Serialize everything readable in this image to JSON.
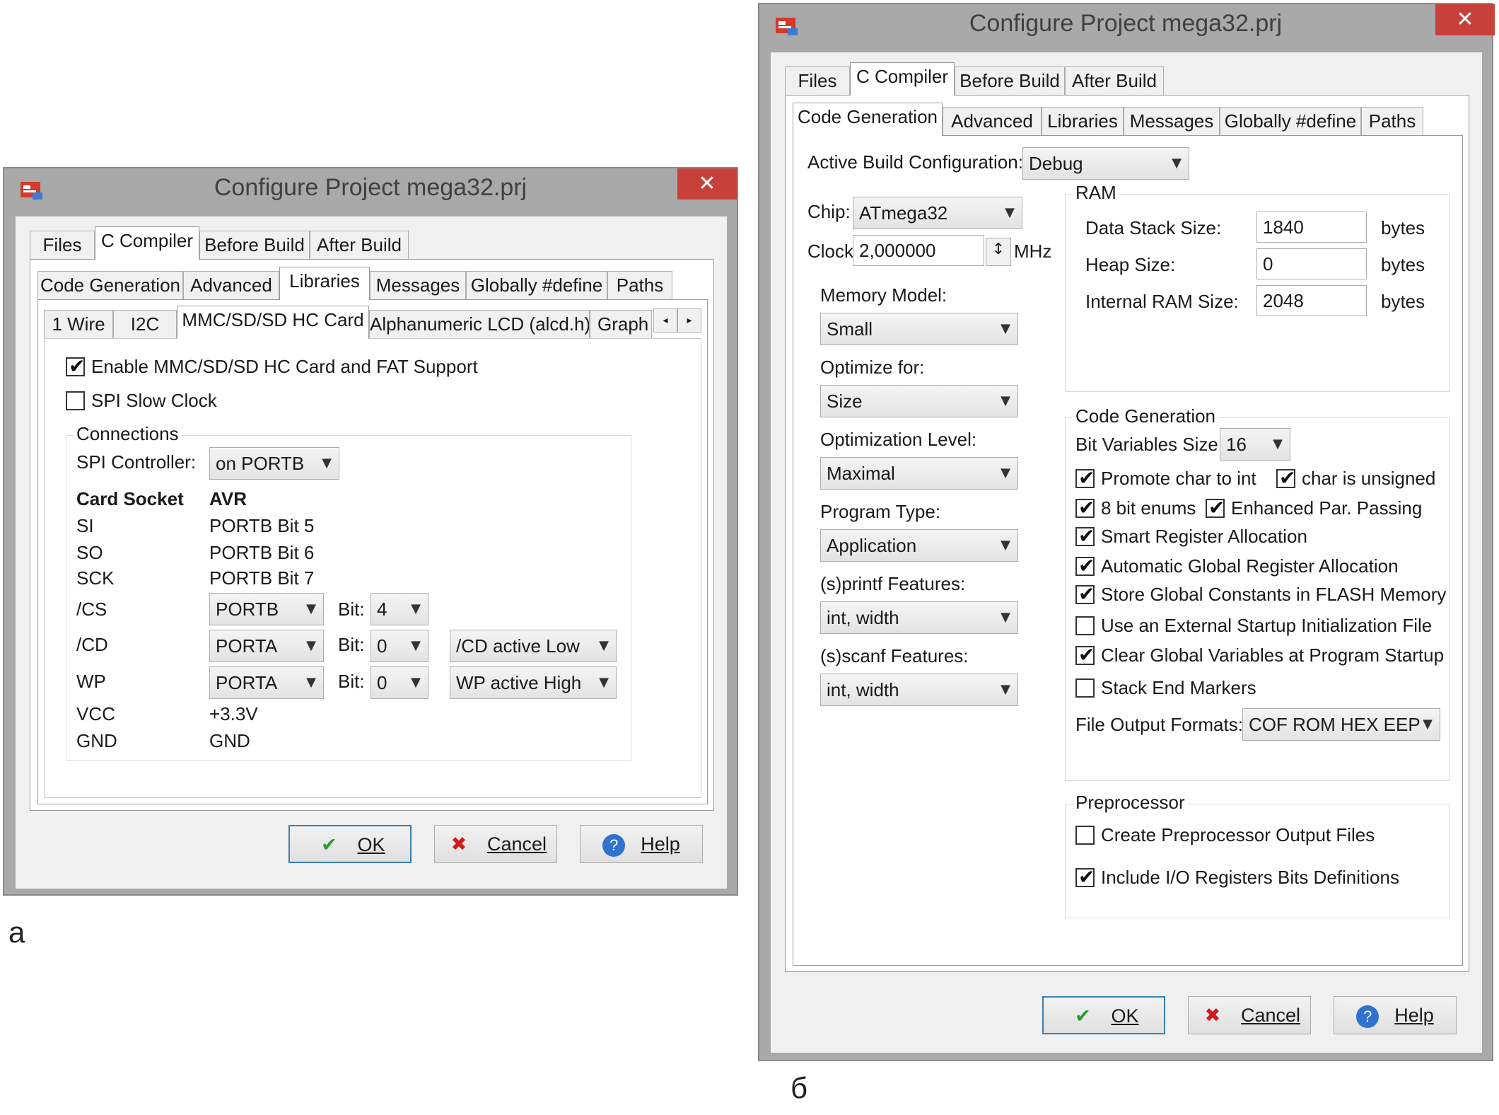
{
  "dialog_a": {
    "title": "Configure Project mega32.prj",
    "close_symbol": "✕",
    "tabs_top": [
      "Files",
      "C Compiler",
      "Before Build",
      "After Build"
    ],
    "tabs_second": [
      "Code Generation",
      "Advanced",
      "Libraries",
      "Messages",
      "Globally #define",
      "Paths"
    ],
    "tabs_third": [
      "1 Wire",
      "I2C",
      "MMC/SD/SD HC Card",
      "Alphanumeric LCD (alcd.h)",
      "Graph"
    ],
    "scroll_left": "◂",
    "scroll_right": "▸",
    "enable_label": "Enable MMC/SD/SD HC Card and FAT Support",
    "spi_slow_label": "SPI Slow Clock",
    "connections_label": "Connections",
    "spi_controller_label": "SPI Controller:",
    "spi_controller_value": "on PORTB",
    "card_socket_header": "Card Socket",
    "avr_header": "AVR",
    "si_label": "SI",
    "si_value": "PORTB Bit 5",
    "so_label": "SO",
    "so_value": "PORTB Bit 6",
    "sck_label": "SCK",
    "sck_value": "PORTB Bit 7",
    "cs_label": "/CS",
    "cs_port": "PORTB",
    "cs_bit_label": "Bit:",
    "cs_bit": "4",
    "cd_label": "/CD",
    "cd_port": "PORTA",
    "cd_bit_label": "Bit:",
    "cd_bit": "0",
    "cd_active": "/CD active Low",
    "wp_label": "WP",
    "wp_port": "PORTA",
    "wp_bit_label": "Bit:",
    "wp_bit": "0",
    "wp_active": "WP active High",
    "vcc_label": "VCC",
    "vcc_value": "+3.3V",
    "gnd_label": "GND",
    "gnd_value": "GND",
    "ok_label": "OK",
    "cancel_label": "Cancel",
    "help_label": "Help",
    "caption": "a"
  },
  "dialog_b": {
    "title": "Configure Project mega32.prj",
    "close_symbol": "✕",
    "tabs_top": [
      "Files",
      "C Compiler",
      "Before Build",
      "After Build"
    ],
    "tabs_second": [
      "Code Generation",
      "Advanced",
      "Libraries",
      "Messages",
      "Globally #define",
      "Paths"
    ],
    "active_build_label": "Active Build Configuration:",
    "active_build_value": "Debug",
    "chip_label": "Chip:",
    "chip_value": "ATmega32",
    "clock_label": "Clock:",
    "clock_value": "2,000000",
    "clock_unit": "MHz",
    "memory_model_label": "Memory Model:",
    "memory_model_value": "Small",
    "optimize_for_label": "Optimize for:",
    "optimize_for_value": "Size",
    "opt_level_label": "Optimization Level:",
    "opt_level_value": "Maximal",
    "program_type_label": "Program Type:",
    "program_type_value": "Application",
    "printf_label": "(s)printf Features:",
    "printf_value": "int, width",
    "scanf_label": "(s)scanf Features:",
    "scanf_value": "int, width",
    "ram_label": "RAM",
    "data_stack_label": "Data Stack Size:",
    "data_stack_value": "1840",
    "heap_label": "Heap Size:",
    "heap_value": "0",
    "internal_ram_label": "Internal RAM Size:",
    "internal_ram_value": "2048",
    "bytes_unit": "bytes",
    "codegen_label": "Code Generation",
    "bitvar_label": "Bit Variables Size:",
    "bitvar_value": "16",
    "opt_promote": "Promote char to int",
    "opt_unsigned": "char is unsigned",
    "opt_8bit": "8 bit enums",
    "opt_enhanced": "Enhanced Par. Passing",
    "opt_smart": "Smart Register Allocation",
    "opt_auto": "Automatic Global Register Allocation",
    "opt_store": "Store Global Constants in FLASH Memory",
    "opt_external": "Use an External Startup Initialization File",
    "opt_clear": "Clear Global Variables at Program Startup",
    "opt_stack_end": "Stack End Markers",
    "file_output_label": "File Output Formats:",
    "file_output_value": "COF ROM HEX EEP",
    "preproc_label": "Preprocessor",
    "preproc_create": "Create Preprocessor Output Files",
    "preproc_include": "Include I/O Registers Bits Definitions",
    "ok_label": "OK",
    "cancel_label": "Cancel",
    "help_label": "Help",
    "caption": "б"
  },
  "icons": {
    "check_mark": "✔",
    "ok_icon": "✔",
    "cancel_icon": "✖",
    "help_icon": "?",
    "combo_arrow": "▼",
    "spin_arrows": "↕"
  },
  "colors": {
    "titlebar": "#a9a9a9",
    "close_button": "#c7403a",
    "ok_check": "#2f9a2f",
    "cancel_x": "#d01c1c",
    "help_blue": "#2f72d0",
    "default_button_border": "#3c7fb1"
  }
}
